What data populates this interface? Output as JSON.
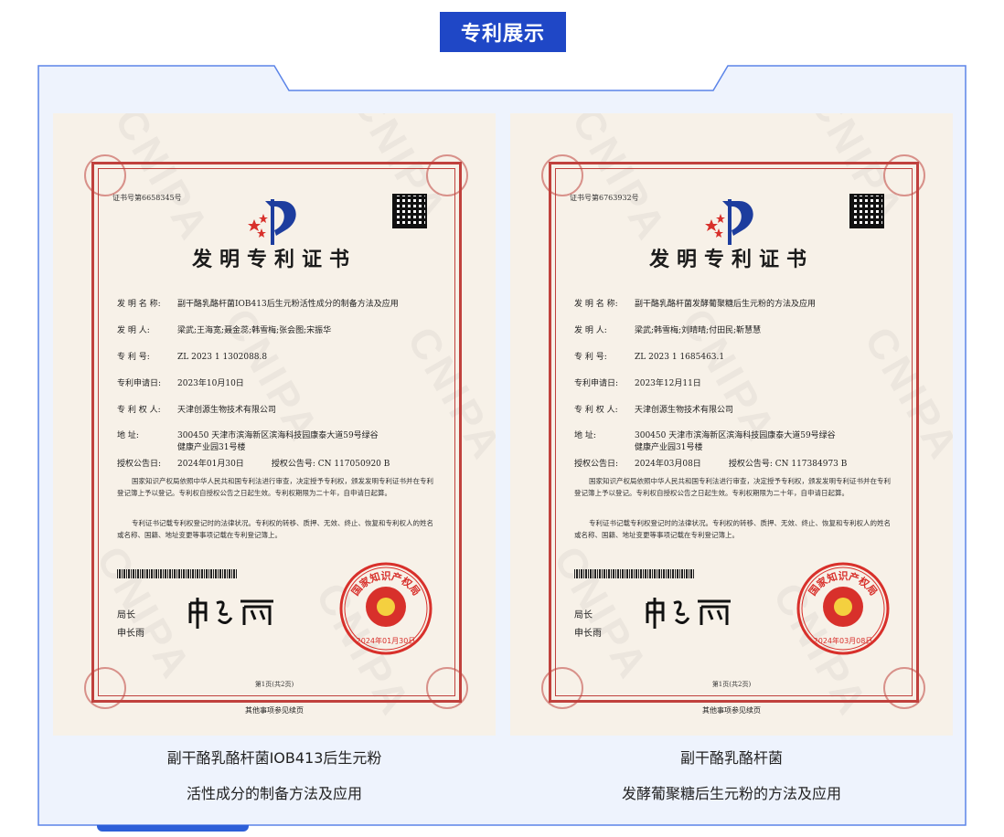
{
  "section": {
    "title": "专利展示"
  },
  "colors": {
    "accent": "#1f47c6",
    "frame": "#5b84e8",
    "certificate_border": "#c0413d",
    "seal": "#d8302b"
  },
  "watermark": "CNIPA",
  "certificates": [
    {
      "serial": "证书号第6658345号",
      "doc_title": "发明专利证书",
      "invention_label": "发 明 名 称:",
      "invention_name": "副干酪乳酪杆菌IOB413后生元粉活性成分的制备方法及应用",
      "inventor_label": "发    明    人:",
      "inventors": "梁武;王海宽;聂金蕊;韩雪梅;张会图;宋振华",
      "patent_no_label": "专        利    号:",
      "patent_no": "ZL 2023 1 1302088.8",
      "filing_label": "专利申请日:",
      "filing_date": "2023年10月10日",
      "owner_label": "专 利 权 人:",
      "owner": "天津创源生物技术有限公司",
      "address_label": "地          址:",
      "address_line1": "300450 天津市滨海新区滨海科技园康泰大道59号绿谷",
      "address_line2": "健康产业园31号楼",
      "grant_label": "授权公告日:",
      "grant_date": "2024年01月30日",
      "grant_no_label": "授权公告号:",
      "grant_no": "CN 117050920 B",
      "paragraph1": "国家知识产权局依照中华人民共和国专利法进行审查，决定授予专利权，颁发发明专利证书并在专利登记簿上予以登记。专利权自授权公告之日起生效。专利权期限为二十年，自申请日起算。",
      "paragraph2": "专利证书记载专利权登记时的法律状况。专利权的转移、质押、无效、终止、恢复和专利权人的姓名或名称、国籍、地址变更等事项记载在专利登记簿上。",
      "director_title": "局长",
      "director_name": "申长雨",
      "seal_text": "国家知识产权局",
      "seal_date": "2024年01月30日",
      "page_no": "第1页(共2页)",
      "footer": "其他事项参见续页",
      "caption_line1": "副干酪乳酪杆菌IOB413后生元粉",
      "caption_line2": "活性成分的制备方法及应用"
    },
    {
      "serial": "证书号第6763932号",
      "doc_title": "发明专利证书",
      "invention_label": "发 明 名 称:",
      "invention_name": "副干酪乳酪杆菌发酵葡聚糖后生元粉的方法及应用",
      "inventor_label": "发    明    人:",
      "inventors": "梁武;韩雪梅;刘晴晴;付田民;靳慧慧",
      "patent_no_label": "专        利    号:",
      "patent_no": "ZL 2023 1 1685463.1",
      "filing_label": "专利申请日:",
      "filing_date": "2023年12月11日",
      "owner_label": "专 利 权 人:",
      "owner": "天津创源生物技术有限公司",
      "address_label": "地          址:",
      "address_line1": "300450 天津市滨海新区滨海科技园康泰大道59号绿谷",
      "address_line2": "健康产业园31号楼",
      "grant_label": "授权公告日:",
      "grant_date": "2024年03月08日",
      "grant_no_label": "授权公告号:",
      "grant_no": "CN 117384973 B",
      "paragraph1": "国家知识产权局依照中华人民共和国专利法进行审查，决定授予专利权，颁发发明专利证书并在专利登记簿上予以登记。专利权自授权公告之日起生效。专利权期限为二十年，自申请日起算。",
      "paragraph2": "专利证书记载专利权登记时的法律状况。专利权的转移、质押、无效、终止、恢复和专利权人的姓名或名称、国籍、地址变更等事项记载在专利登记簿上。",
      "director_title": "局长",
      "director_name": "申长雨",
      "seal_text": "国家知识产权局",
      "seal_date": "2024年03月08日",
      "page_no": "第1页(共2页)",
      "footer": "其他事项参见续页",
      "caption_line1": "副干酪乳酪杆菌",
      "caption_line2": "发酵葡聚糖后生元粉的方法及应用"
    }
  ]
}
